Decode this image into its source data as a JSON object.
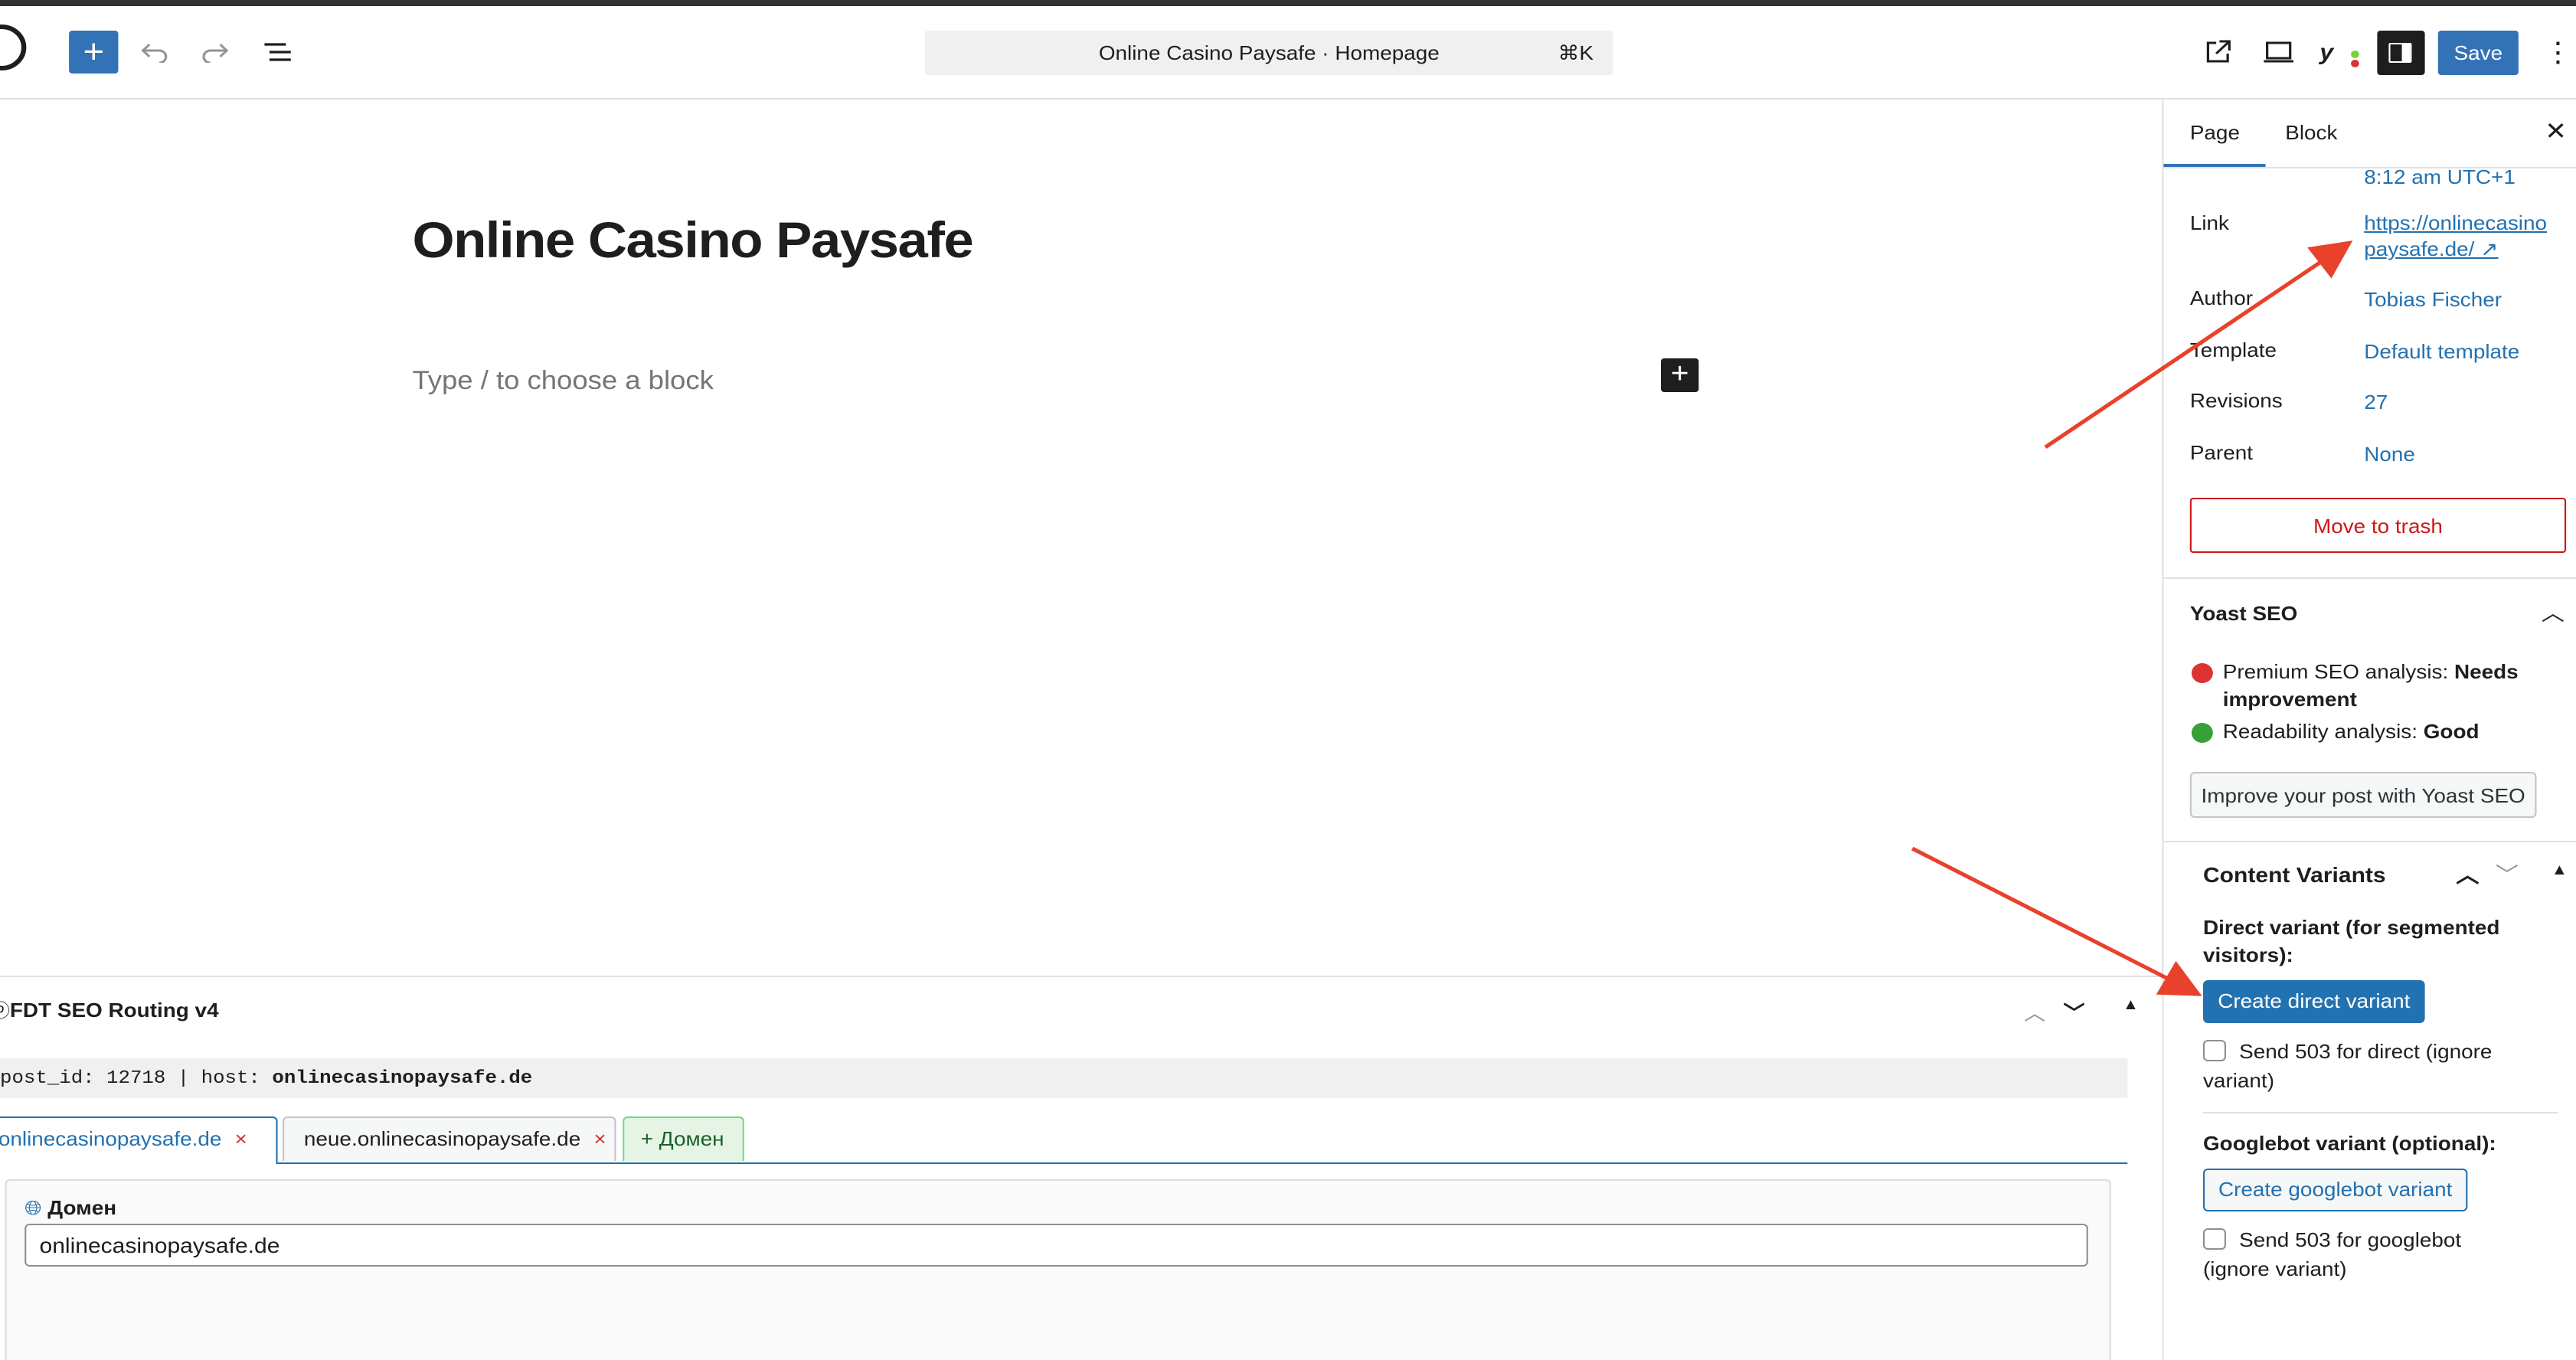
{
  "header": {
    "title": "Online Casino Paysafe · Homepage",
    "shortcut": "⌘K",
    "save_label": "Save"
  },
  "editor": {
    "post_title": "Online Casino Paysafe",
    "placeholder": "Type / to choose a block"
  },
  "sidebar": {
    "tabs": [
      "Page",
      "Block"
    ],
    "time": "8:12 am UTC+1",
    "rows": [
      {
        "label": "Link",
        "value": "https://onlinecasino paysafe.de/ ↗"
      },
      {
        "label": "Author",
        "value": "Tobias Fischer"
      },
      {
        "label": "Template",
        "value": "Default template"
      },
      {
        "label": "Revisions",
        "value": "27"
      },
      {
        "label": "Parent",
        "value": "None"
      }
    ],
    "trash_label": "Move to trash",
    "yoast": {
      "title": "Yoast SEO",
      "seo_label": "Premium SEO analysis: ",
      "seo_value": "Needs improvement",
      "readability_label": "Readability analysis: ",
      "readability_value": "Good",
      "button": "Improve your post with Yoast SEO"
    },
    "content_variants": {
      "title": "Content Variants",
      "direct_label": "Direct variant (for segmented visitors):",
      "direct_button": "Create direct variant",
      "direct_503": "Send 503 for direct (ignore variant)",
      "googlebot_label": "Googlebot variant (optional):",
      "googlebot_button": "Create googlebot variant",
      "googlebot_503": "Send 503 for googlebot (ignore variant)"
    }
  },
  "metabox": {
    "title": "FDT SEO Routing v4",
    "info_prefix": "post_id: 12718 | host: ",
    "info_host": "onlinecasinopaysafe.de",
    "tabs": [
      {
        "label": "onlinecasinopaysafe.de",
        "close": "×"
      },
      {
        "label": "neue.onlinecasinopaysafe.de",
        "close": "×"
      }
    ],
    "add_tab": "+ Домен",
    "field_label": "Домен",
    "field_value": "onlinecasinopaysafe.de"
  },
  "colors": {
    "accent": "#3373b5",
    "link": "#2271b1",
    "danger": "#cc1818",
    "arrow": "#e8412c",
    "good": "#36a136",
    "bad": "#dc3232"
  }
}
